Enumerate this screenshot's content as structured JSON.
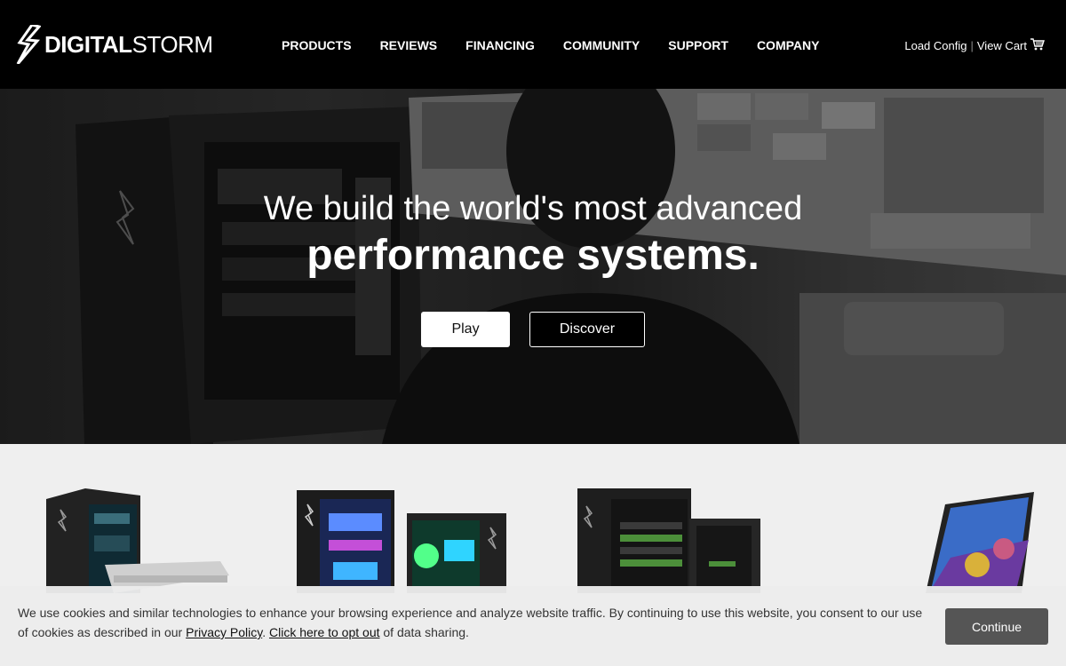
{
  "brand": {
    "logo_bold": "DIGITAL",
    "logo_thin": "STORM"
  },
  "nav": {
    "items": [
      {
        "label": "PRODUCTS"
      },
      {
        "label": "REVIEWS"
      },
      {
        "label": "FINANCING"
      },
      {
        "label": "COMMUNITY"
      },
      {
        "label": "SUPPORT"
      },
      {
        "label": "COMPANY"
      }
    ]
  },
  "utility": {
    "load_config": "Load Config",
    "separator": "|",
    "view_cart": "View Cart",
    "cart_icon": "cart-icon"
  },
  "hero": {
    "line1": "We build the world's most advanced",
    "line2": "performance systems.",
    "play_label": "Play",
    "discover_label": "Discover"
  },
  "products": {
    "items": [
      {
        "name": "workstation-and-server"
      },
      {
        "name": "gaming-desktops"
      },
      {
        "name": "pro-workstations"
      },
      {
        "name": "gaming-laptop"
      }
    ]
  },
  "cookie": {
    "text_before": "We use cookies and similar technologies to enhance your browsing experience and analyze website traffic. By continuing to use this website, you consent to our use of cookies as described in our ",
    "privacy_link": "Privacy Policy",
    "text_mid": ". ",
    "optout_link": "Click here to opt out",
    "text_after": " of data sharing.",
    "continue_label": "Continue"
  },
  "colors": {
    "header_bg": "#000000",
    "page_bg": "#efefef",
    "continue_bg": "#555555"
  }
}
